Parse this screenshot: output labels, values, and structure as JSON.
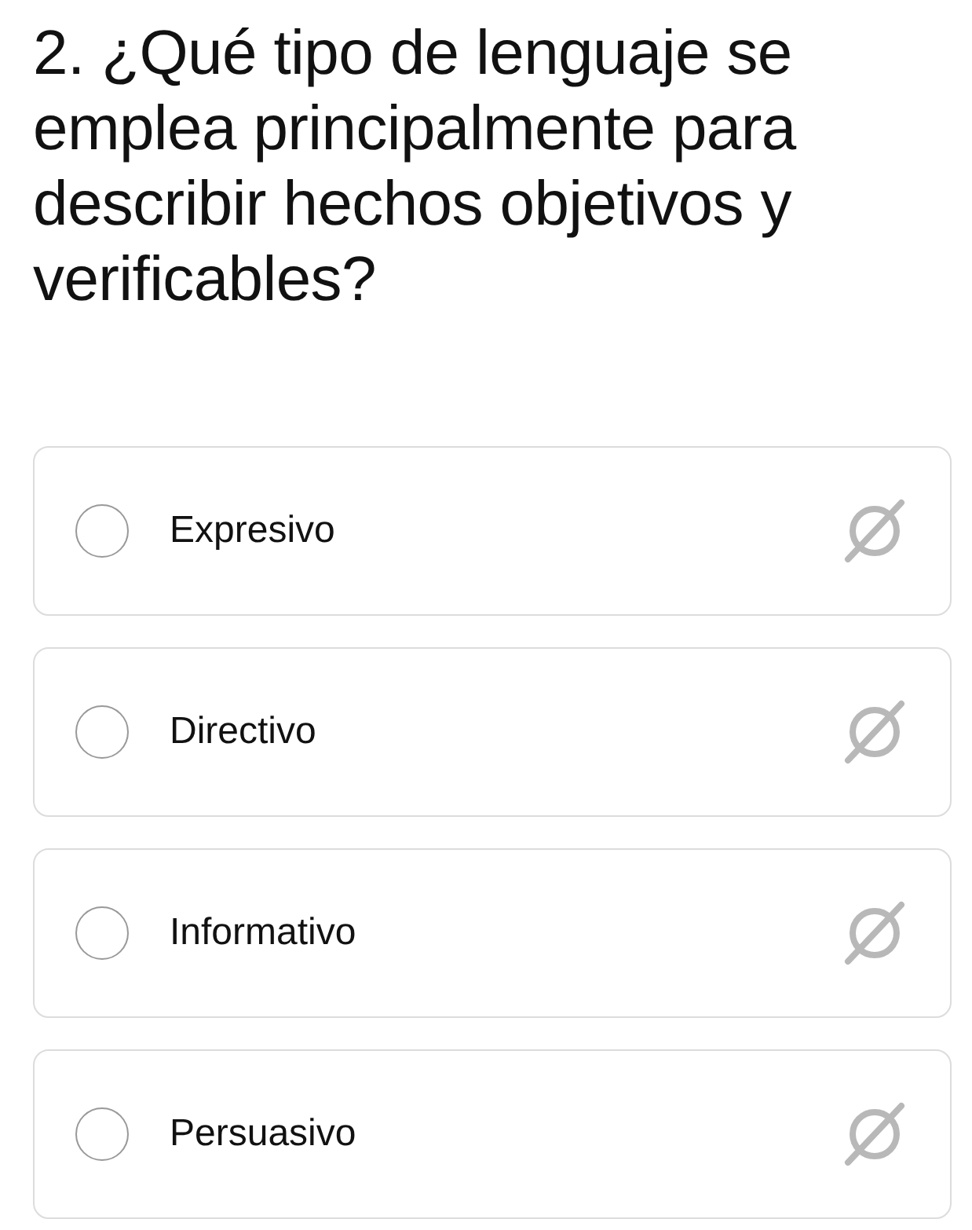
{
  "question": "2. ¿Qué tipo de lenguaje se emplea principalmente para describir hechos objetivos y verificables?",
  "options": [
    {
      "label": "Expresivo",
      "selected": false
    },
    {
      "label": "Directivo",
      "selected": false
    },
    {
      "label": "Informativo",
      "selected": false
    },
    {
      "label": "Persuasivo",
      "selected": false
    }
  ]
}
